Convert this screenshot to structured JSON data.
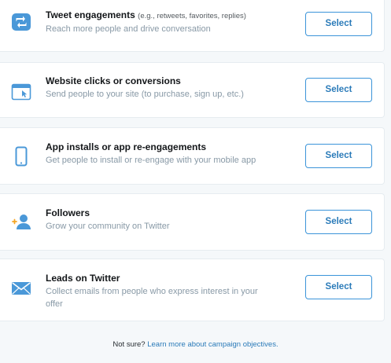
{
  "objectives": [
    {
      "icon": "retweet-icon",
      "title": "Tweet engagements",
      "hint": "(e.g., retweets, favorites, replies)",
      "description": "Reach more people and drive conversation",
      "button_label": "Select"
    },
    {
      "icon": "browser-click-icon",
      "title": "Website clicks or conversions",
      "hint": "",
      "description": "Send people to your site (to purchase, sign up, etc.)",
      "button_label": "Select"
    },
    {
      "icon": "mobile-phone-icon",
      "title": "App installs or app re-engagements",
      "hint": "",
      "description": "Get people to install or re-engage with your mobile app",
      "button_label": "Select"
    },
    {
      "icon": "add-follower-icon",
      "title": "Followers",
      "hint": "",
      "description": "Grow your community on Twitter",
      "button_label": "Select"
    },
    {
      "icon": "envelope-icon",
      "title": "Leads on Twitter",
      "hint": "",
      "description": "Collect emails from people who express interest in your offer",
      "button_label": "Select"
    }
  ],
  "footer": {
    "prefix": "Not sure?",
    "link_text": "Learn more about campaign objectives."
  },
  "colors": {
    "accent": "#2b7bb9",
    "button_border": "#3b94d9",
    "icon_blue": "#4a98d8",
    "follower_plus": "#f5a623",
    "muted_text": "#8899a6"
  }
}
